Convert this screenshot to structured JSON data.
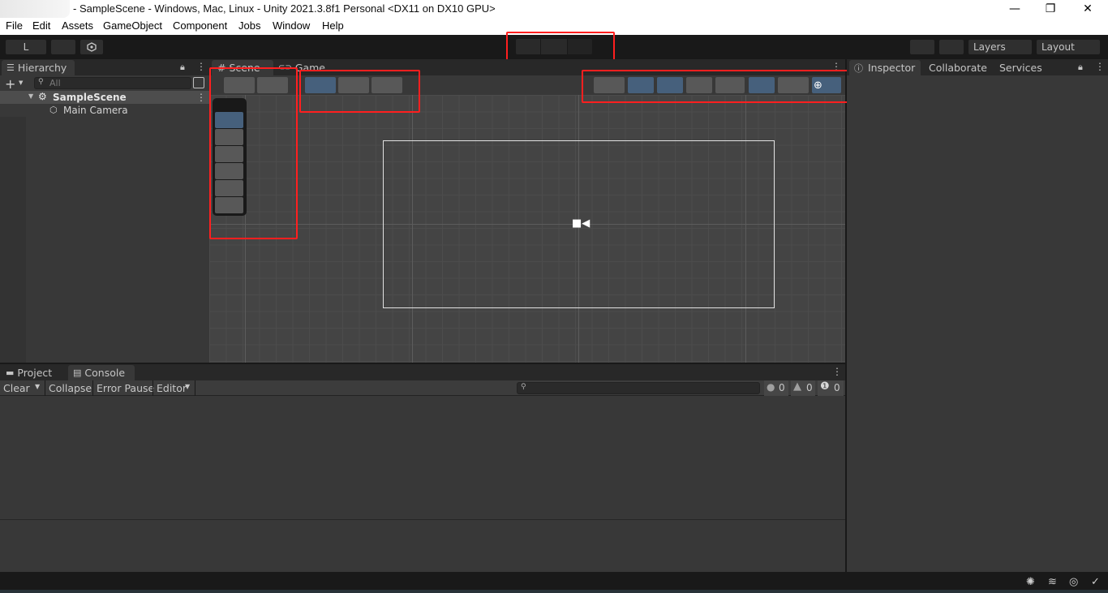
{
  "window": {
    "title": "- SampleScene - Windows, Mac, Linux - Unity 2021.3.8f1 Personal <DX11 on DX10 GPU>",
    "minimize": "—",
    "maximize": "❐",
    "close": "✕"
  },
  "menu": [
    "File",
    "Edit",
    "Assets",
    "GameObject",
    "Component",
    "Jobs",
    "Window",
    "Help"
  ],
  "toolbar": {
    "account_label": "L",
    "layers_label": "Layers",
    "layout_label": "Layout"
  },
  "hierarchy": {
    "tab_label": "Hierarchy",
    "add_label": "+",
    "search_placeholder": "All",
    "scene_name": "SampleScene",
    "items": [
      "Main Camera"
    ]
  },
  "scene": {
    "tabs": [
      "Scene",
      "Game"
    ]
  },
  "inspector": {
    "tabs": [
      "Inspector",
      "Collaborate",
      "Services"
    ]
  },
  "bottom": {
    "tabs": [
      "Project",
      "Console"
    ],
    "console_toolbar": {
      "clear": "Clear",
      "collapse": "Collapse",
      "error_pause": "Error Pause",
      "editor": "Editor",
      "log_count": "0",
      "warning_count": "0",
      "error_count": "0"
    }
  },
  "icons": {
    "hierarchy": "list-icon",
    "scene": "hash-icon",
    "game": "gamepad-icon",
    "inspector": "info-icon",
    "project": "folder-icon",
    "console": "console-icon",
    "camera": "camera-icon"
  },
  "colors": {
    "accent": "#46607c",
    "highlight_red": "#ff1f1f",
    "panel": "#383838",
    "toolbar": "#191919"
  }
}
